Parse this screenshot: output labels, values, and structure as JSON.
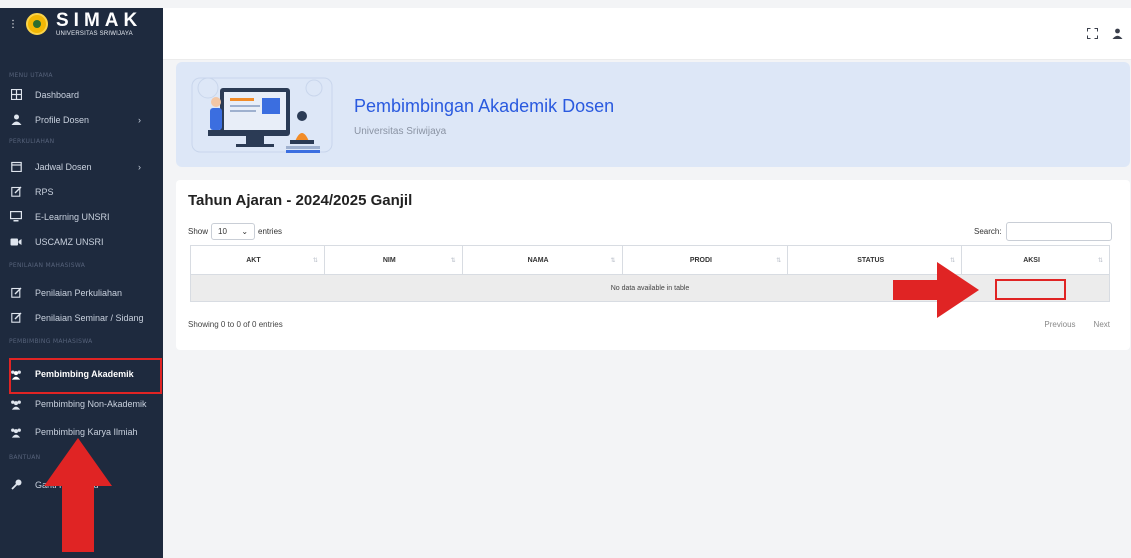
{
  "brand": {
    "title": "SIMAK",
    "subtitle": "UNIVERSITAS SRIWIJAYA"
  },
  "sidebar": {
    "sections": [
      "MENU UTAMA",
      "PERKULIAHAN",
      "PENILAIAN MAHASISWA",
      "PEMBIMBING MAHASISWA",
      "BANTUAN"
    ],
    "items": [
      {
        "label": "Dashboard"
      },
      {
        "label": "Profile Dosen"
      },
      {
        "label": "Jadwal Dosen"
      },
      {
        "label": "RPS"
      },
      {
        "label": "E-Learning UNSRI"
      },
      {
        "label": "USCAMZ UNSRI"
      },
      {
        "label": "Penilaian Perkuliahan"
      },
      {
        "label": "Penilaian Seminar / Sidang"
      },
      {
        "label": "Pembimbing Akademik"
      },
      {
        "label": "Pembimbing Non-Akademik"
      },
      {
        "label": "Pembimbing Karya Ilmiah"
      },
      {
        "label": "Ganti Password"
      }
    ]
  },
  "banner": {
    "title": "Pembimbingan Akademik Dosen",
    "subtitle": "Universitas Sriwijaya"
  },
  "card": {
    "title": "Tahun Ajaran - 2024/2025 Ganjil",
    "show_label": "Show",
    "entries_value": "10",
    "entries_label": "entries",
    "search_label": "Search:",
    "columns": [
      "AKT",
      "NIM",
      "NAMA",
      "PRODI",
      "STATUS",
      "AKSI"
    ],
    "empty_text": "No data available in table",
    "info": "Showing 0 to 0 of 0 entries",
    "prev": "Previous",
    "next": "Next"
  },
  "colors": {
    "sidebar": "#1e2a3e",
    "accent": "#2a5adf",
    "banner": "#dde7f7",
    "annotation": "#e02424"
  },
  "icons": {
    "toggle": "vertical-dots-icon",
    "fullscreen": "fullscreen-icon",
    "user": "user-icon"
  }
}
